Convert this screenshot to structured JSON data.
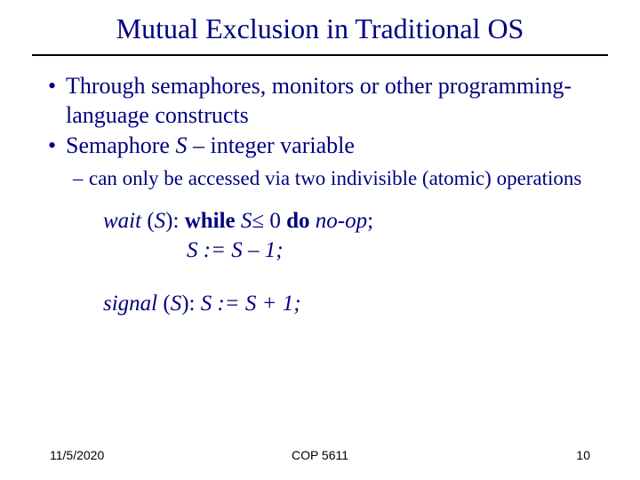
{
  "title": "Mutual Exclusion in Traditional OS",
  "bullets": {
    "b1": "Through semaphores, monitors or other programming-language constructs",
    "b2_prefix": "Semaphore ",
    "b2_var": "S",
    "b2_suffix": " – integer variable",
    "sub1": "can only be accessed via two indivisible (atomic) operations"
  },
  "code": {
    "wait_lhs_italic": "wait",
    "wait_paren_open": " (",
    "wait_var": "S",
    "wait_paren_close": "):  ",
    "while_kw": "while",
    "while_cond_pre": " ",
    "while_var": "S",
    "while_cond_post": "≤ 0 ",
    "do_kw": "do",
    "noop": " no-op",
    "semicolon": ";",
    "line2": "S := S – 1;",
    "signal_italic": "signal",
    "signal_paren_open": " (",
    "signal_var": "S",
    "signal_paren_close": "): ",
    "signal_body": "S := S + 1;"
  },
  "footer": {
    "date": "11/5/2020",
    "course": "COP 5611",
    "page": "10"
  }
}
